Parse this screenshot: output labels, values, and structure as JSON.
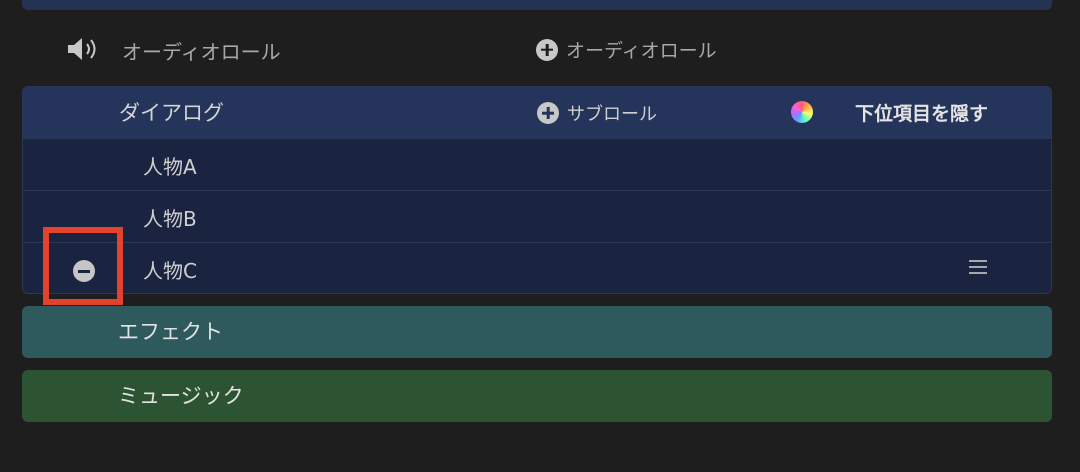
{
  "audio_roles": {
    "label": "オーディオロール",
    "add_button_label": "オーディオロール"
  },
  "dialogue": {
    "title": "ダイアログ",
    "add_subrole_label": "サブロール",
    "hide_subroles_label": "下位項目を隠す",
    "subroles": [
      {
        "name": "人物A"
      },
      {
        "name": "人物B"
      },
      {
        "name": "人物C"
      }
    ]
  },
  "effects": {
    "title": "エフェクト"
  },
  "music": {
    "title": "ミュージック"
  },
  "icons": {
    "speaker": "speaker-icon",
    "add": "plus-circle-icon",
    "remove": "minus-circle-icon",
    "color": "color-wheel-icon",
    "drag": "drag-handle-icon"
  },
  "colors": {
    "background": "#1e1e1e",
    "dialogue_header": "#24345a",
    "dialogue_rows": "#1a2440",
    "effects": "#2e5a5e",
    "music": "#2c5432",
    "highlight": "#e3422c"
  }
}
